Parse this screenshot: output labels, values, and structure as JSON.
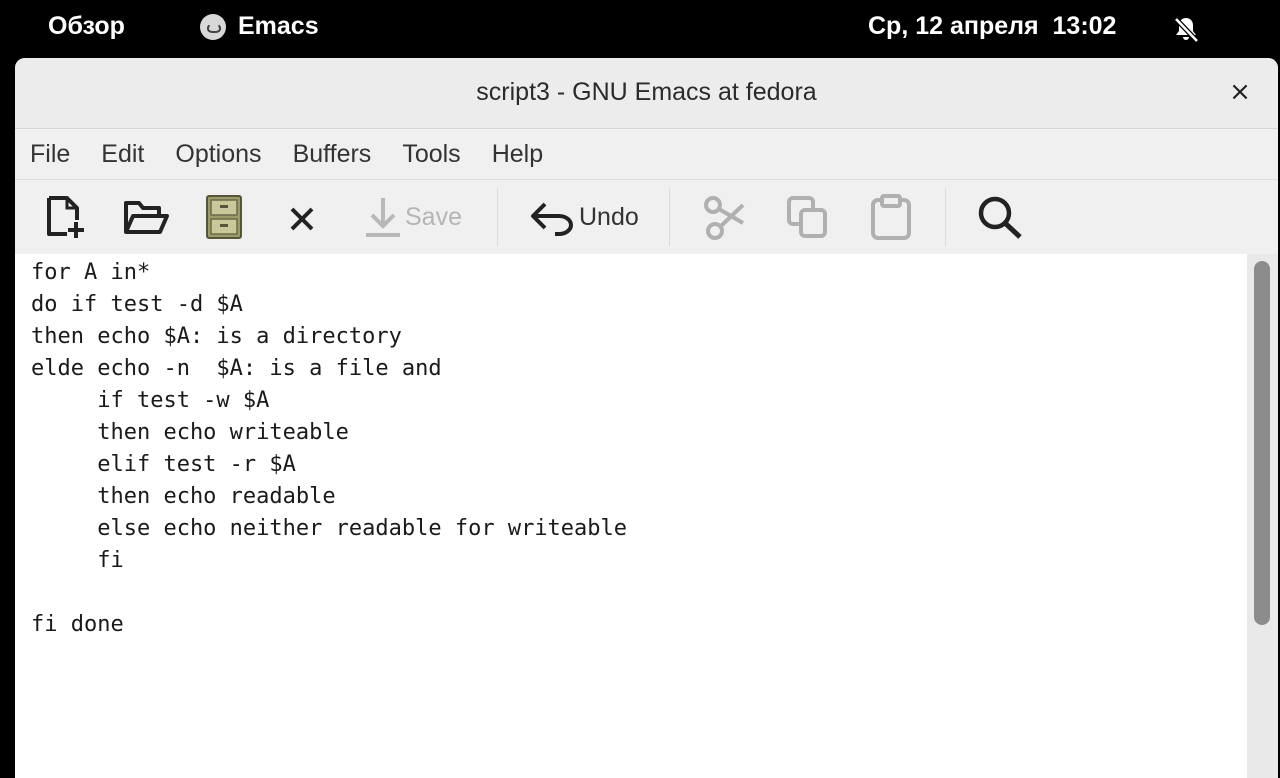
{
  "topbar": {
    "activities": "Обзор",
    "app_name": "Emacs",
    "clock": "Ср, 12 апреля  13:02",
    "status_icon": "notifications-disabled-icon"
  },
  "window": {
    "title": "script3 - GNU Emacs at fedora",
    "close_glyph": "×"
  },
  "menubar": {
    "items": [
      "File",
      "Edit",
      "Options",
      "Buffers",
      "Tools",
      "Help"
    ]
  },
  "toolbar": {
    "buttons": [
      {
        "icon": "new-file-icon",
        "enabled": true
      },
      {
        "icon": "open-folder-icon",
        "enabled": true
      },
      {
        "icon": "dired-cabinet-icon",
        "enabled": true
      },
      {
        "icon": "close-buffer-icon",
        "enabled": true
      },
      {
        "icon": "save-icon",
        "label": "Save",
        "enabled": false
      },
      {
        "icon": "undo-icon",
        "label": "Undo",
        "enabled": true
      },
      {
        "icon": "cut-icon",
        "enabled": false
      },
      {
        "icon": "copy-icon",
        "enabled": false
      },
      {
        "icon": "paste-icon",
        "enabled": false
      },
      {
        "icon": "search-icon",
        "enabled": true
      }
    ],
    "save_label": "Save",
    "undo_label": "Undo"
  },
  "editor": {
    "lines": [
      "for A in*",
      "do if test -d $A",
      "then echo $A: is a directory",
      "elde echo -n  $A: is a file and",
      "     if test -w $A",
      "     then echo writeable",
      "     elif test -r $A",
      "     then echo readable",
      "     else echo neither readable for writeable",
      "     fi",
      "",
      "fi done"
    ]
  },
  "colors": {
    "topbar_bg": "#000000",
    "window_bg": "#f2f2f2",
    "editor_bg": "#ffffff",
    "disabled_text": "#b5b5b5"
  }
}
